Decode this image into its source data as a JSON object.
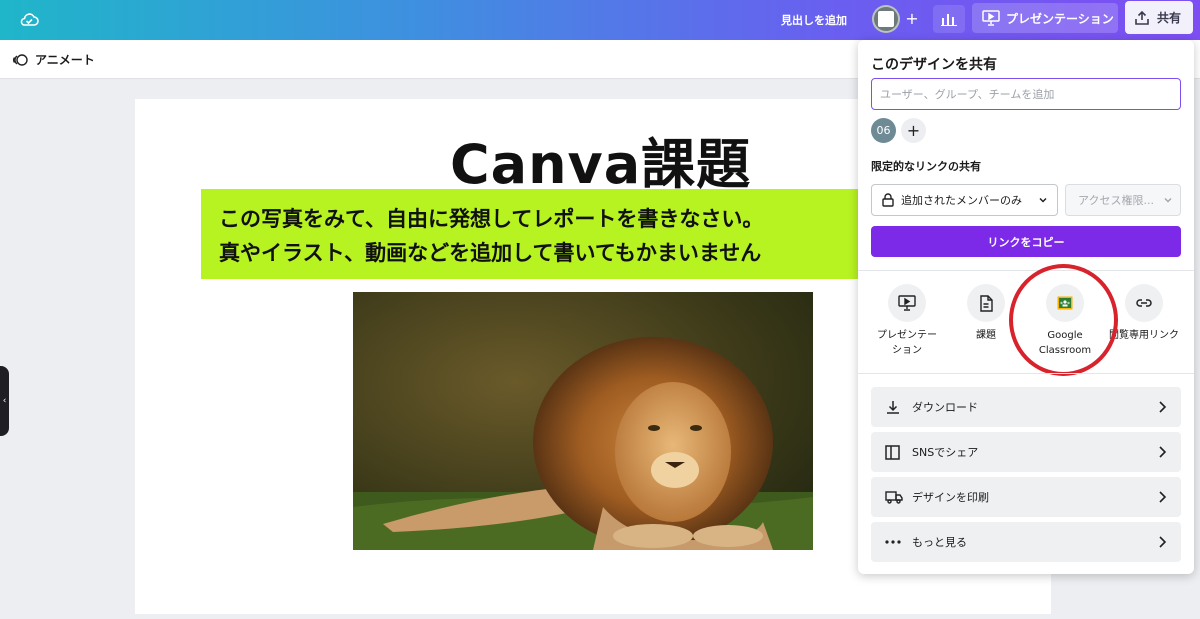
{
  "topbar": {
    "heading_button": "見出しを追加",
    "present_label": "プレゼンテーション",
    "share_label": "共有"
  },
  "subbar": {
    "animate_label": "アニメート"
  },
  "canvas": {
    "title": "Canva課題",
    "banner_line1": "この写真をみて、自由に発想してレポートを書きなさい。",
    "banner_line2": "真やイラスト、動画などを追加して書いてもかまいません"
  },
  "share_panel": {
    "title": "このデザインを共有",
    "people_input_placeholder": "ユーザー、グループ、チームを追加",
    "avatar_initials": "06",
    "link_section_label": "限定的なリンクの共有",
    "access_select_value": "追加されたメンバーのみ",
    "permission_select_value": "アクセス権限...",
    "copy_link_button": "リンクをコピー",
    "options": [
      {
        "label": "プレゼンテー\nション",
        "icon": "presentation-icon"
      },
      {
        "label": "課題",
        "icon": "document-icon"
      },
      {
        "label": "Google\nClassroom",
        "icon": "google-classroom-icon"
      },
      {
        "label": "閲覧専用リンク",
        "icon": "link-icon"
      }
    ],
    "rows": [
      {
        "label": "ダウンロード",
        "icon": "download-icon"
      },
      {
        "label": "SNSでシェア",
        "icon": "social-share-icon"
      },
      {
        "label": "デザインを印刷",
        "icon": "print-truck-icon"
      },
      {
        "label": "もっと見る",
        "icon": "more-dots-icon"
      }
    ]
  },
  "colors": {
    "accent": "#7d2ae8",
    "banner": "#b7f221",
    "highlight_ring": "#d8222c"
  }
}
